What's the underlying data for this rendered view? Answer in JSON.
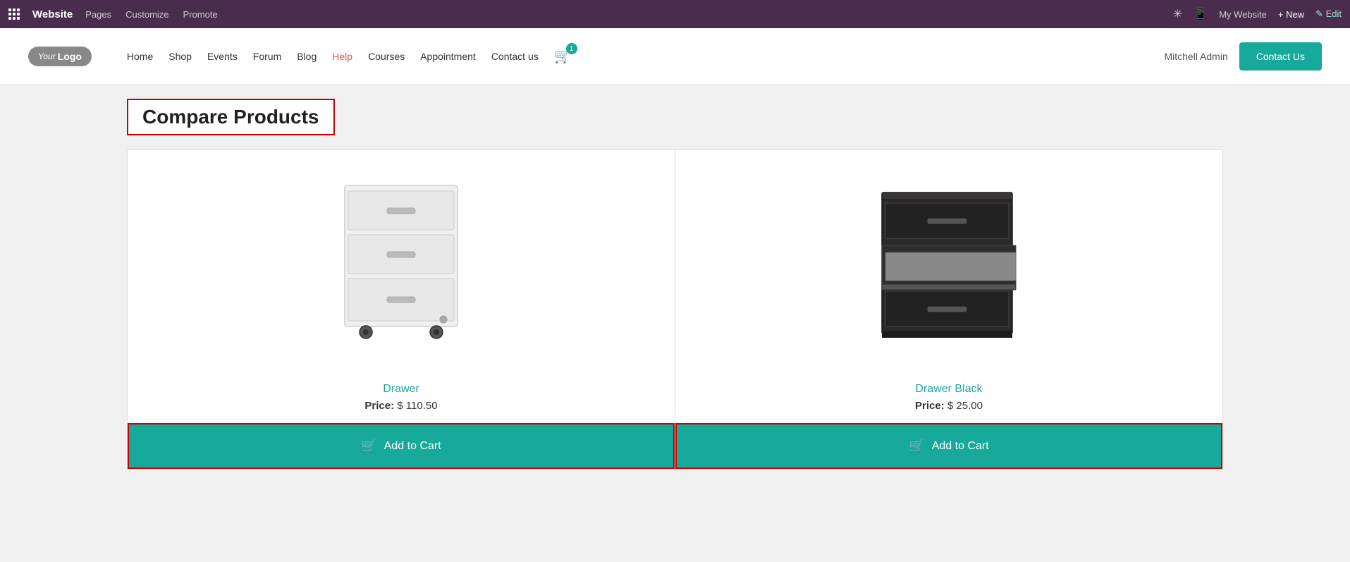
{
  "admin_bar": {
    "site_name": "Website",
    "nav_items": [
      "Pages",
      "Customize",
      "Promote"
    ],
    "website_label": "My Website",
    "new_label": "+ New",
    "edit_label": "✎ Edit"
  },
  "nav": {
    "logo_your": "Your",
    "logo_text": "Logo",
    "links": [
      "Home",
      "Shop",
      "Events",
      "Forum",
      "Blog",
      "Help",
      "Courses",
      "Appointment",
      "Contact us"
    ],
    "cart_count": "1",
    "admin_user": "Mitchell Admin",
    "contact_us_btn": "Contact Us"
  },
  "page": {
    "title": "Compare Products"
  },
  "products": [
    {
      "name": "Drawer",
      "price_label": "Price:",
      "price_value": "$ 110.50",
      "add_to_cart": "Add to Cart"
    },
    {
      "name": "Drawer Black",
      "price_label": "Price:",
      "price_value": "$ 25.00",
      "add_to_cart": "Add to Cart"
    }
  ]
}
